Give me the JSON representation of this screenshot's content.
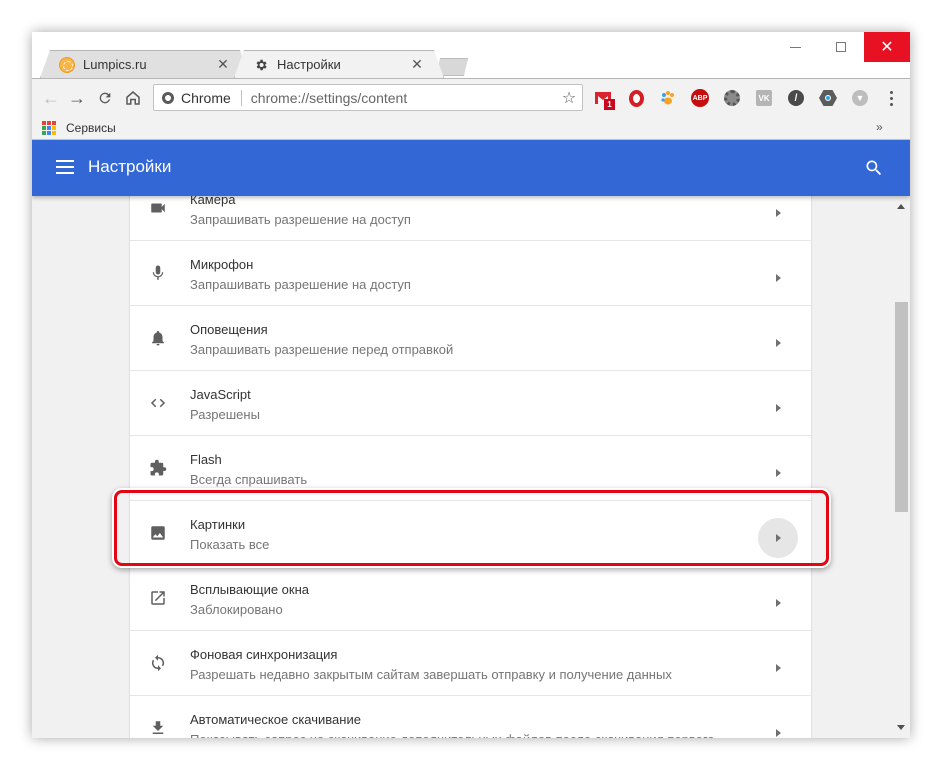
{
  "window": {
    "controls": {
      "minimize": "—",
      "maximize": "☐",
      "close": "✕"
    }
  },
  "tabs": [
    {
      "label": "Lumpics.ru",
      "icon": "orange-favicon",
      "close": "✕",
      "active": false
    },
    {
      "label": "Настройки",
      "icon": "gear-icon",
      "close": "✕",
      "active": true
    }
  ],
  "toolbar": {
    "back": "←",
    "forward": "→",
    "reload": "C",
    "home": "⌂",
    "omnibox": {
      "chip": "Chrome",
      "url": "chrome://settings/content",
      "star": "☆"
    },
    "extensions": [
      {
        "name": "gmail-notifier",
        "badge": "1"
      },
      {
        "name": "adblock-opera"
      },
      {
        "name": "paw-extension"
      },
      {
        "name": "adblock-plus",
        "label": "ABP"
      },
      {
        "name": "film-reel"
      },
      {
        "name": "vk-extension",
        "label": "VK"
      },
      {
        "name": "brush-extension"
      },
      {
        "name": "eye-extension"
      },
      {
        "name": "cloud-download"
      }
    ]
  },
  "bookmarks": {
    "apps_label": "Сервисы",
    "more": "»",
    "apps_colors": [
      "#ea4335",
      "#ea4335",
      "#ea4335",
      "#34a853",
      "#4285f4",
      "#fbbc05",
      "#34a853",
      "#4285f4",
      "#fbbc05"
    ]
  },
  "header": {
    "title": "Настройки",
    "accent": "#3367d6"
  },
  "settings": [
    {
      "id": "camera",
      "title": "Камера",
      "subtitle": "Запрашивать разрешение на доступ",
      "icon": "camera-icon"
    },
    {
      "id": "microphone",
      "title": "Микрофон",
      "subtitle": "Запрашивать разрешение на доступ",
      "icon": "microphone-icon"
    },
    {
      "id": "notifications",
      "title": "Оповещения",
      "subtitle": "Запрашивать разрешение перед отправкой",
      "icon": "bell-icon"
    },
    {
      "id": "javascript",
      "title": "JavaScript",
      "subtitle": "Разрешены",
      "icon": "code-icon"
    },
    {
      "id": "flash",
      "title": "Flash",
      "subtitle": "Всегда спрашивать",
      "icon": "puzzle-icon"
    },
    {
      "id": "images",
      "title": "Картинки",
      "subtitle": "Показать все",
      "icon": "image-icon",
      "highlighted": true
    },
    {
      "id": "popups",
      "title": "Всплывающие окна",
      "subtitle": "Заблокировано",
      "icon": "open-in-new-icon"
    },
    {
      "id": "background-sync",
      "title": "Фоновая синхронизация",
      "subtitle": "Разрешать недавно закрытым сайтам завершать отправку и получение данных",
      "icon": "sync-icon"
    },
    {
      "id": "auto-downloads",
      "title": "Автоматическое скачивание",
      "subtitle": "Показывать запрос на скачивание дополнительных файлов после скачивания первого",
      "icon": "download-icon"
    }
  ],
  "highlight_color": "#e30613"
}
